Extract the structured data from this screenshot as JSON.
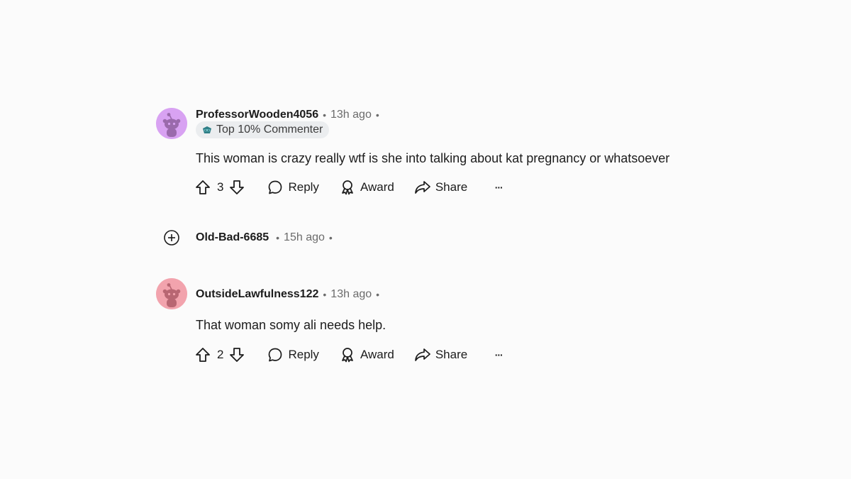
{
  "comments": [
    {
      "username": "ProfessorWooden4056",
      "time": "13h ago",
      "badge": "Top 10% Commenter",
      "text": "This woman is crazy really wtf is she into talking about kat pregnancy or whatsoever",
      "votes": "3",
      "avatar_color": "#d8a2f2",
      "avatar_fg": "#9a6aac"
    },
    {
      "username": "OutsideLawfulness122",
      "time": "13h ago",
      "text": "That woman somy ali needs help.",
      "votes": "2",
      "avatar_color": "#f2a3ad",
      "avatar_fg": "#b86672"
    }
  ],
  "collapsed_comment": {
    "username": "Old-Bad-6685",
    "time": "15h ago"
  },
  "actions": {
    "reply": "Reply",
    "award": "Award",
    "share": "Share",
    "more": "···"
  },
  "separator": "•",
  "icons": {
    "upvote": "upvote-icon",
    "downvote": "downvote-icon",
    "reply": "chat-bubble-icon",
    "award": "award-icon",
    "share": "share-arrow-icon",
    "more": "ellipsis-icon",
    "expand": "plus-circle-icon"
  }
}
